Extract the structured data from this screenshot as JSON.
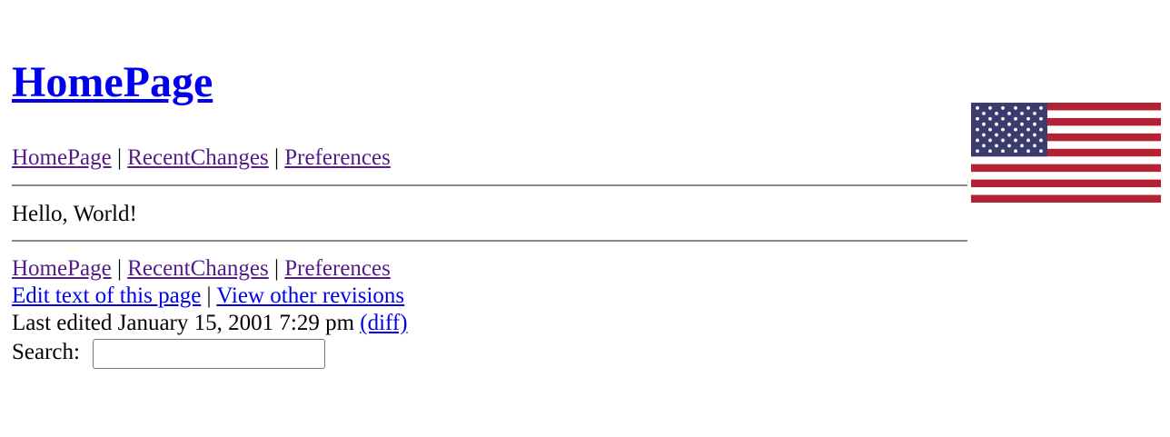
{
  "header": {
    "title": "HomePage"
  },
  "nav_top": {
    "items": [
      "HomePage",
      "RecentChanges",
      "Preferences"
    ],
    "separator": "|"
  },
  "content": {
    "text": "Hello, World!"
  },
  "nav_bottom": {
    "items": [
      "HomePage",
      "RecentChanges",
      "Preferences"
    ],
    "separator": "|"
  },
  "actions": {
    "edit_label": "Edit text of this page",
    "revisions_label": "View other revisions",
    "separator": "|"
  },
  "meta": {
    "last_edited": "Last edited January 15, 2001 7:29 pm",
    "diff_label": "(diff)"
  },
  "search": {
    "label": "Search:",
    "value": ""
  },
  "flag": {
    "icon": "us-flag-icon",
    "stripe_red": "#b22234",
    "canton_blue": "#3c3b6e",
    "white": "#ffffff"
  },
  "colors": {
    "link": "#0000ee",
    "visited": "#551a8b",
    "rule": "#8a8a8a"
  }
}
